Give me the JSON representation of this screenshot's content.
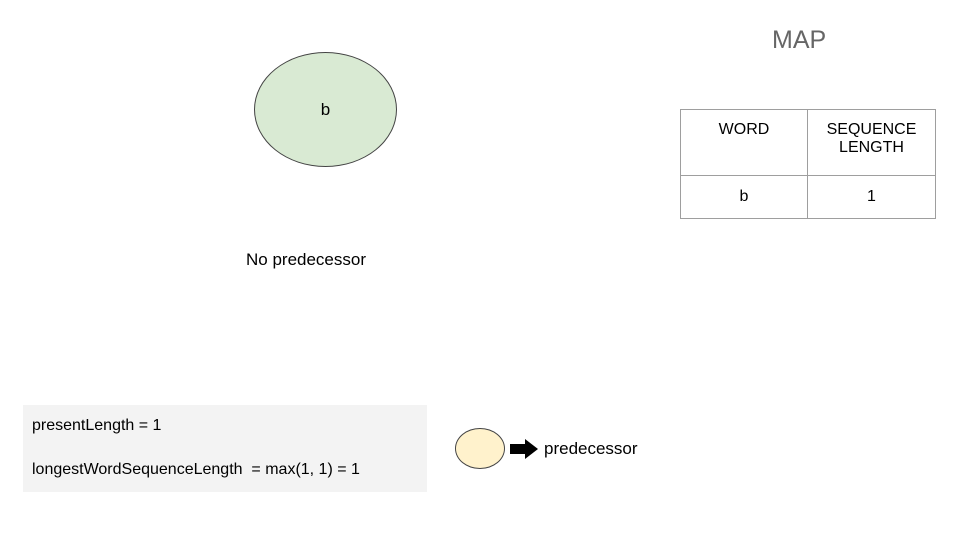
{
  "node": {
    "label": "b",
    "caption": "No predecessor"
  },
  "map": {
    "title": "MAP",
    "headers": {
      "word": "WORD",
      "length_line1": "SEQUENCE",
      "length_line2": "LENGTH"
    },
    "rows": [
      {
        "word": "b",
        "length": "1"
      }
    ]
  },
  "code": {
    "line1": "presentLength = 1",
    "line2": "longestWordSequenceLength  = max(1, 1) = 1"
  },
  "legend": {
    "label": "predecessor"
  },
  "colors": {
    "node_fill": "#d9ead3",
    "legend_node_fill": "#fff2cc",
    "code_bg": "#f3f3f3",
    "title_color": "#666666"
  }
}
